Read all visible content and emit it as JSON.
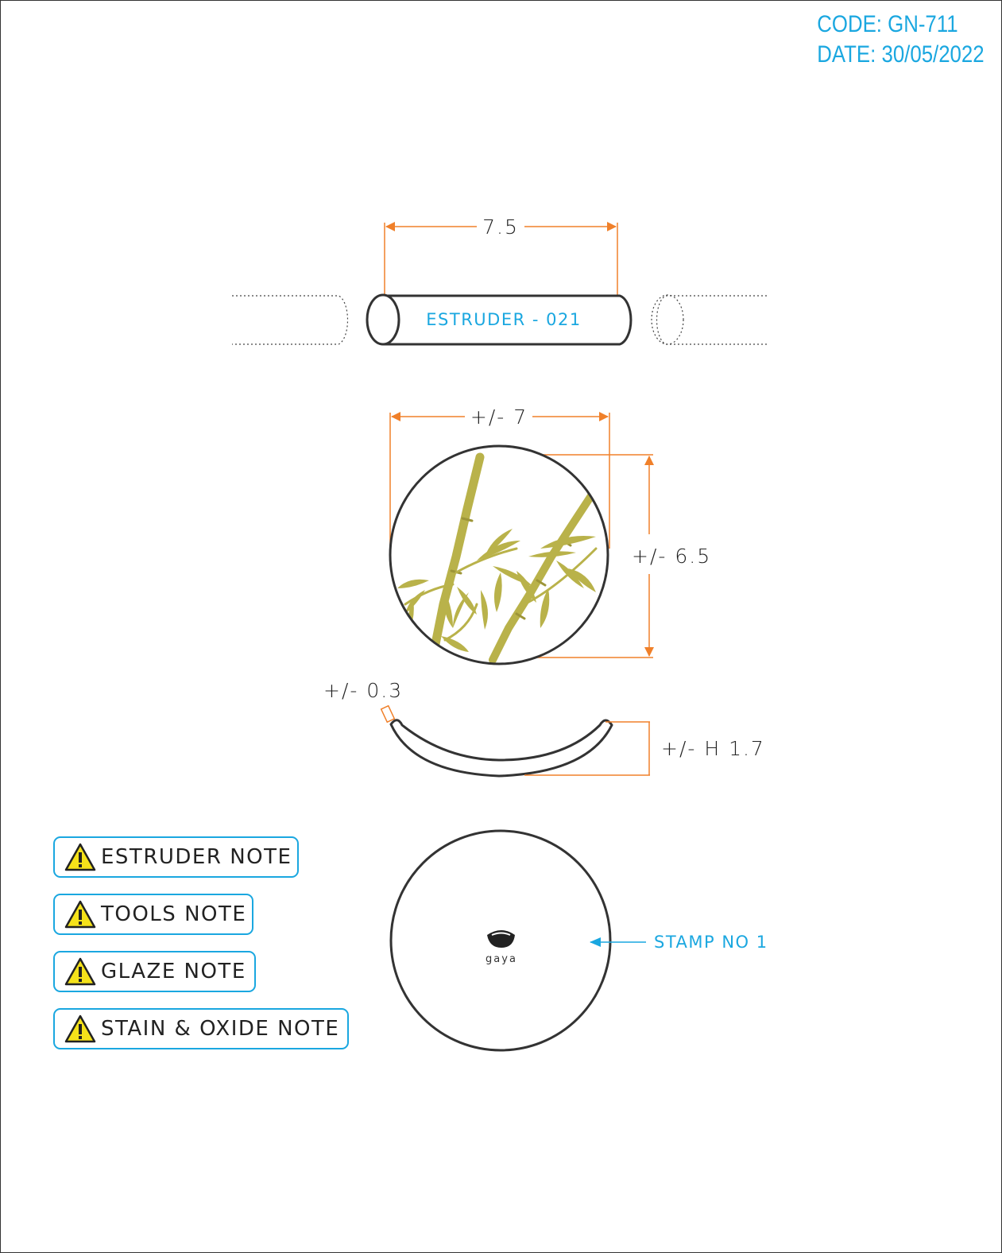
{
  "header": {
    "code": "CODE: GN-711",
    "date": "DATE: 30/05/2022"
  },
  "extruder": {
    "length_label": "7.5",
    "name": "ESTRUDER - 021"
  },
  "top_view": {
    "width_label": "+/- 7",
    "height_label": "+/- 6.5"
  },
  "side_view": {
    "thickness_label": "+/- 0.3",
    "height_label": "+/- H 1.7"
  },
  "stamp": {
    "logo_text": "gaya",
    "label": "STAMP NO 1"
  },
  "notes": [
    {
      "label": "ESTRUDER NOTE",
      "icon": "warning-icon"
    },
    {
      "label": "TOOLS NOTE",
      "icon": "warning-icon"
    },
    {
      "label": "GLAZE NOTE",
      "icon": "warning-icon"
    },
    {
      "label": "STAIN & OXIDE NOTE",
      "icon": "warning-icon"
    }
  ],
  "colors": {
    "dimension": "#f0802a",
    "accent_blue": "#1aa7e0",
    "outline": "#333333",
    "bamboo": "#b9b24a",
    "warning_yellow": "#f5e21a"
  }
}
